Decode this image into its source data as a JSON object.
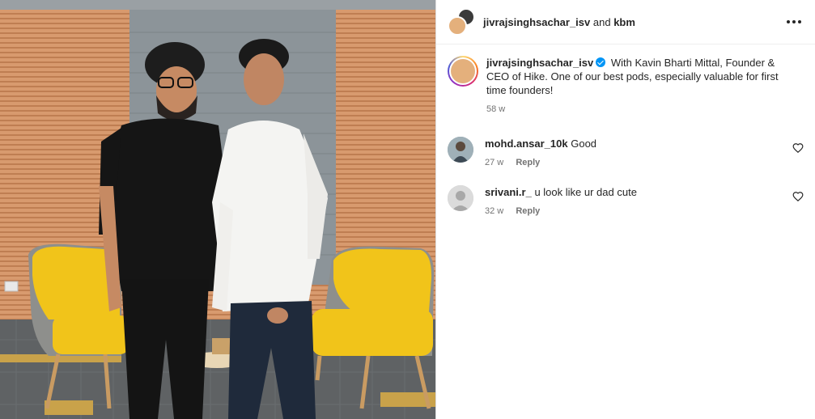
{
  "header": {
    "user_primary": "jivrajsinghsachar_isv",
    "and_text": "and",
    "user_secondary": "kbm"
  },
  "caption": {
    "username": "jivrajsinghsachar_isv",
    "text": "With Kavin Bharti Mittal, Founder & CEO of Hike. One of our best pods, especially valuable for first time founders!",
    "time": "58 w"
  },
  "comments": [
    {
      "username": "mohd.ansar_10k",
      "text": "Good",
      "time": "27 w",
      "reply_label": "Reply",
      "avatar_icon": "profile-photo"
    },
    {
      "username": "srivani.r_",
      "text": "u look like ur dad cute",
      "time": "32 w",
      "reply_label": "Reply",
      "avatar_icon": "default-avatar-icon"
    }
  ],
  "icons": {
    "more": "more-options-icon",
    "like": "heart-icon",
    "verified": "verified-badge-icon"
  },
  "colors": {
    "verified_blue": "#0095f6",
    "text_primary": "#262626",
    "text_secondary": "#737373",
    "chair_yellow": "#f2c200",
    "wall_wood": "#d6956a"
  }
}
